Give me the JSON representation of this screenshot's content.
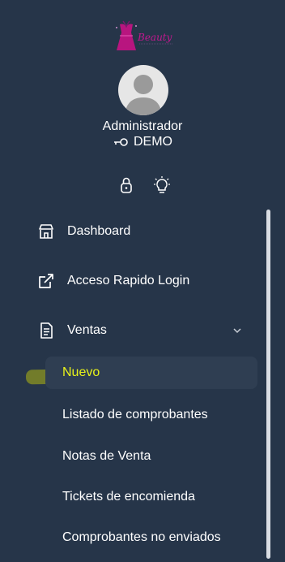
{
  "brand": {
    "logo_text": "Beauty"
  },
  "user": {
    "name": "Administrador",
    "company": "DEMO"
  },
  "quick_actions": [
    {
      "icon": "lock-icon"
    },
    {
      "icon": "lightbulb-icon"
    }
  ],
  "menu": {
    "dashboard": "Dashboard",
    "quick_access": "Acceso Rapido Login",
    "sales": "Ventas",
    "sales_submenu": {
      "new": "Nuevo",
      "receipts_list": "Listado de comprobantes",
      "sale_notes": "Notas de Venta",
      "parcel_tickets": "Tickets de encomienda",
      "unsent_receipts": "Comprobantes no enviados"
    }
  },
  "colors": {
    "sidebar_bg": "#263549",
    "active_text": "#e8f21a",
    "active_bg": "#2f3e52",
    "logo_pink": "#c2188f"
  }
}
